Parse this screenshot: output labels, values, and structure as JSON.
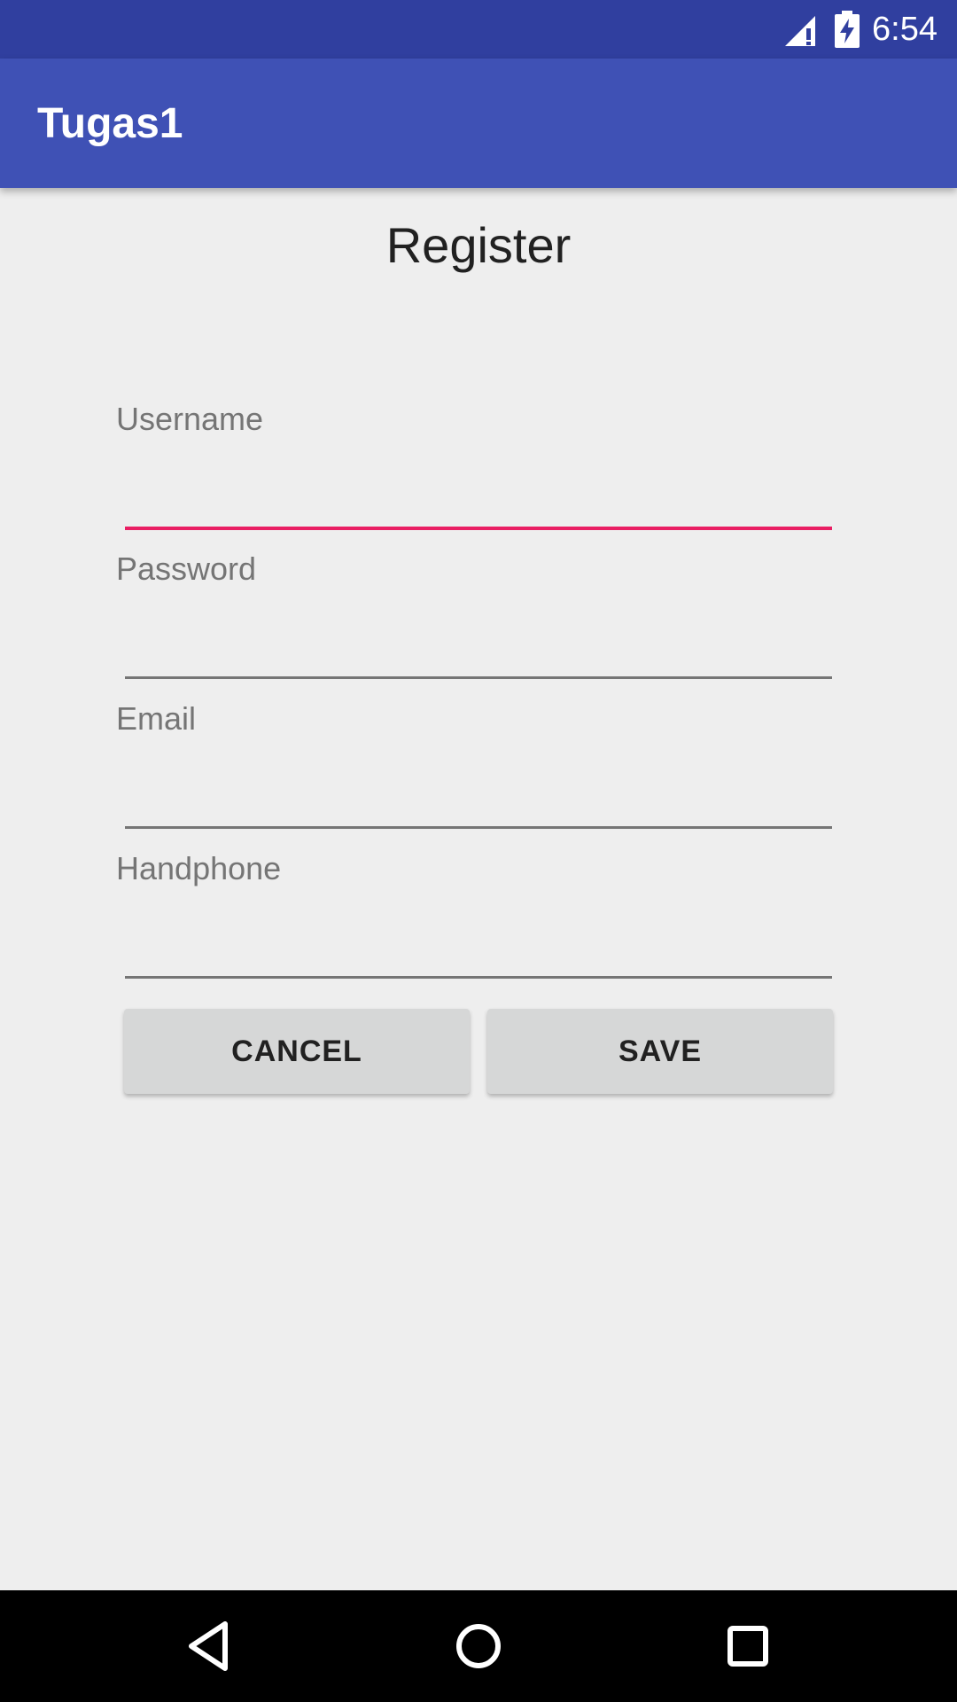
{
  "status_bar": {
    "time": "6:54",
    "icons": [
      "signal-alert-icon",
      "battery-charging-icon"
    ]
  },
  "app_bar": {
    "title": "Tugas1",
    "color": "#3f51b5"
  },
  "form": {
    "heading": "Register",
    "fields": [
      {
        "label": "Username",
        "value": "",
        "focused": true
      },
      {
        "label": "Password",
        "value": "",
        "focused": false
      },
      {
        "label": "Email",
        "value": "",
        "focused": false
      },
      {
        "label": "Handphone",
        "value": "",
        "focused": false
      }
    ],
    "cancel_label": "CANCEL",
    "save_label": "SAVE"
  },
  "nav_bar": {
    "icons": [
      "back-icon",
      "home-icon",
      "recents-icon"
    ]
  },
  "colors": {
    "status_bar": "#303f9f",
    "primary": "#3f51b5",
    "accent": "#e91e63",
    "background": "#eeeeee"
  }
}
